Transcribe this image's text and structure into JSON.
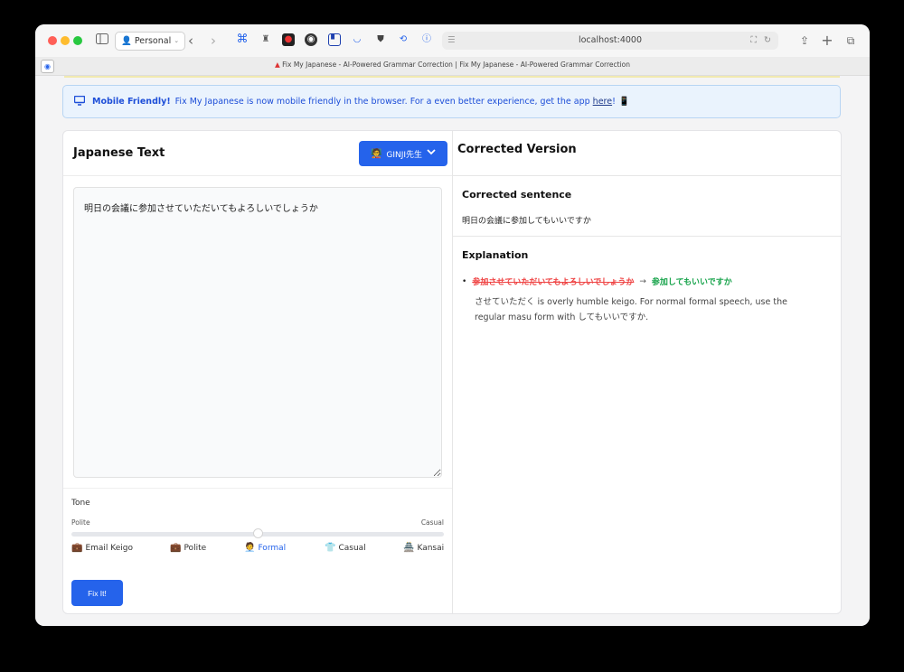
{
  "browser": {
    "profile_label": "Personal",
    "url": "localhost:4000",
    "tab_title": "Fix My Japanese - AI-Powered Grammar Correction | Fix My Japanese - AI-Powered Grammar Correction"
  },
  "banner": {
    "heading": "Mobile Friendly!",
    "message": "Fix My Japanese is now mobile friendly in the browser. For a even better experience, get the app",
    "link": "here",
    "suffix": "!",
    "phone_icon": "📱"
  },
  "left_panel": {
    "title": "Japanese Text",
    "sensei_button": "GINJI先生",
    "sensei_icon": "🧑‍🏫",
    "input_text": "明日の会議に参加させていただいてもよろしいでしょうか",
    "tone": {
      "label": "Tone",
      "min_label": "Polite",
      "max_label": "Casual",
      "level_percent": 50,
      "options": [
        {
          "icon": "💼",
          "label": "Email Keigo"
        },
        {
          "icon": "💼",
          "label": "Polite"
        },
        {
          "icon": "🧑‍💼",
          "label": "Formal"
        },
        {
          "icon": "👕",
          "label": "Casual"
        },
        {
          "icon": "🏯",
          "label": "Kansai"
        }
      ],
      "selected": "Formal"
    },
    "submit_label": "Fix It!"
  },
  "right_panel": {
    "title": "Corrected Version",
    "corrected_heading": "Corrected sentence",
    "corrected_text": "明日の会議に参加してもいいですか",
    "explanation_heading": "Explanation",
    "explanation": {
      "original": "参加させていただいてもよろしいでしょうか",
      "arrow": "→",
      "replacement": "参加してもいいですか",
      "note": "させていただく is overly humble keigo. For normal formal speech, use the regular masu form with してもいいですか."
    }
  },
  "colors": {
    "accent": "#2563eb",
    "strike_red": "#ef4444",
    "fix_green": "#16a34a"
  }
}
